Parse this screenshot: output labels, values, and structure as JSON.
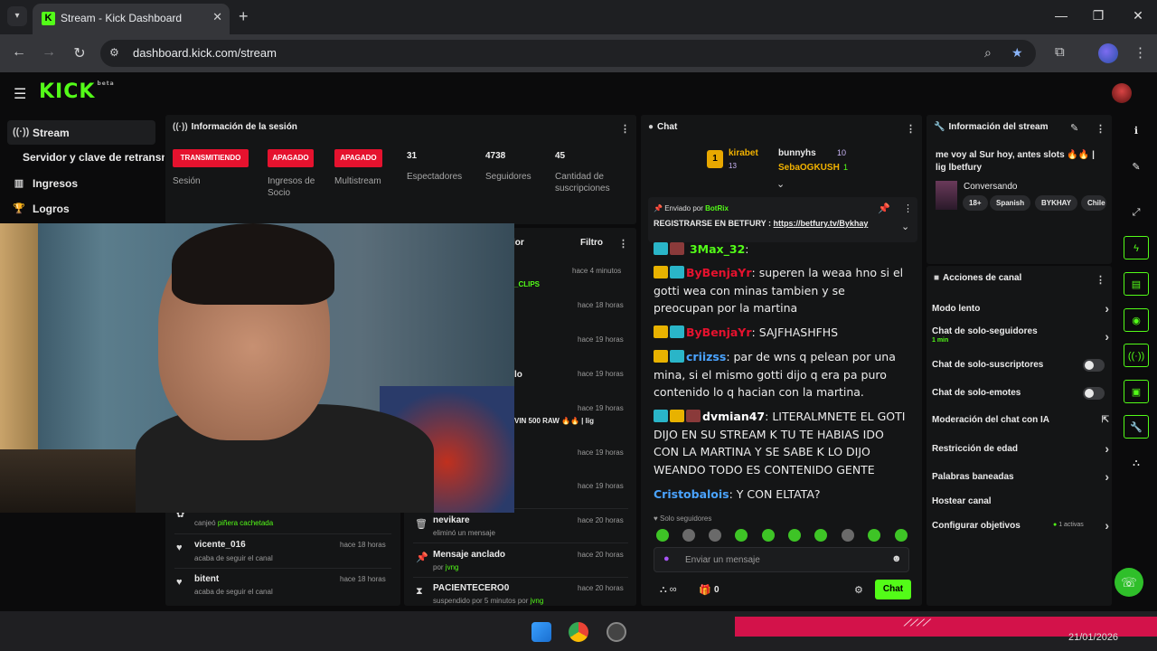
{
  "browser": {
    "tab_title": "Stream - Kick Dashboard",
    "url": "dashboard.kick.com/stream",
    "tab_close": "✕",
    "new_tab": "+"
  },
  "header": {
    "logo": "KICK"
  },
  "sidebar": {
    "items": [
      {
        "label": "Stream",
        "icon": "broadcast-icon"
      },
      {
        "label": "Servidor y clave de retransmisión"
      },
      {
        "label": "Ingresos",
        "icon": "chart-icon"
      },
      {
        "label": "Logros",
        "icon": "trophy-icon"
      }
    ]
  },
  "session": {
    "title": "Información de la sesión",
    "badges": [
      "TRANSMITIENDO",
      "APAGADO",
      "APAGADO"
    ],
    "badge_labels": [
      "Sesión",
      "Ingresos de Socio",
      "Multistream"
    ],
    "stats": [
      {
        "value": "31",
        "label": "Espectadores"
      },
      {
        "value": "4738",
        "label": "Seguidores"
      },
      {
        "value": "45",
        "label": "Cantidad de suscripciones"
      }
    ]
  },
  "activity": {
    "rows": [
      {
        "title": "",
        "sub_pre": "canjeó",
        "sub_hl": "piñera cachetada",
        "time": ""
      },
      {
        "title": "vicente_016",
        "sub": "acaba de seguir el canal",
        "time": "hace 18 horas"
      },
      {
        "title": "bitent",
        "sub": "acaba de seguir el canal",
        "time": "hace 18 horas"
      }
    ]
  },
  "modlog": {
    "title_tail": "lor",
    "filter": "Filtro",
    "times": [
      "hace 4 minutos",
      "hace 18 horas",
      "hace 19 horas",
      "hace 19 horas",
      "hace 19 horas",
      "hace 19 horas",
      "hace 19 horas"
    ],
    "fragments": [
      "_CLIPS",
      "lo",
      "VIN 500 RAW 🔥🔥 | lig"
    ],
    "rows": [
      {
        "title": "nevikare",
        "sub": "eliminó un mensaje",
        "time": "hace 20 horas"
      },
      {
        "title": "Mensaje anclado",
        "sub_pre": "por",
        "sub_hl": "jvng",
        "time": "hace 20 horas"
      },
      {
        "title": "PACIENTECERO0",
        "sub_pre": "suspendido por 5 minutos por",
        "sub_hl": "jvng",
        "time": "hace 20 horas"
      }
    ]
  },
  "chat": {
    "title": "Chat",
    "gifters": [
      {
        "name": "kirabet",
        "count": "13"
      },
      {
        "name": "bunnyhs",
        "count": "10"
      },
      {
        "name": "SebaOGKUSH",
        "count": "1"
      }
    ],
    "pinned": {
      "by_label": "Enviado por",
      "by_user": "BotRix",
      "text": "REGISTRARSE EN BETFURY :",
      "link": "https://betfury.tv/Bykhay"
    },
    "messages": [
      {
        "user": "3Max_32",
        "text": ""
      },
      {
        "user": "ByBenjaYr",
        "text": "superen la weaa hno si el gotti wea con minas tambien y se preocupan por la martina"
      },
      {
        "user": "ByBenjaYr",
        "text": "SAJFHASHFHS"
      },
      {
        "user": "criizss",
        "text": "par de wns q pelean por una mina, si el mismo gotti dijo q era pa puro contenido lo q hacian con la martina."
      },
      {
        "user": "dvmian47",
        "text": "LITERALMNETE EL GOTI DIJO EN SU STREAM K TU TE HABIAS IDO CON LA MARTINA Y SE SABE K LO DIJO WEANDO TODO ES CONTENIDO GENTE"
      },
      {
        "user": "Cristobalois",
        "text": "Y CON ELTATA?"
      }
    ],
    "followers_only": "Solo seguidores",
    "placeholder": "Enviar un mensaje",
    "viewer_count": "0",
    "send": "Chat"
  },
  "stream_info": {
    "title": "Información del stream",
    "stream_title": "me voy al Sur hoy, antes slots 🔥🔥 | lig lbetfury",
    "category": "Conversando",
    "tags": [
      "18+",
      "Spanish",
      "BYKHAY",
      "Chile"
    ]
  },
  "actions": {
    "title": "Acciones de canal",
    "items": [
      {
        "label": "Modo lento",
        "kind": "chevron"
      },
      {
        "label": "Chat de solo-seguidores",
        "sub": "1 min",
        "kind": "chevron"
      },
      {
        "label": "Chat de solo-suscriptores",
        "kind": "toggle"
      },
      {
        "label": "Chat de solo-emotes",
        "kind": "toggle"
      },
      {
        "label": "Moderación del chat con IA",
        "kind": "external"
      },
      {
        "label": "Restricción de edad",
        "kind": "chevron"
      },
      {
        "label": "Palabras baneadas",
        "kind": "chevron"
      },
      {
        "label": "Hostear canal",
        "kind": "none"
      },
      {
        "label": "Configurar objetivos",
        "sub": "1 activas",
        "kind": "chevron"
      }
    ]
  },
  "taskbar": {
    "date": "21/01/2026"
  },
  "colors": {
    "kick_green": "#53fc18",
    "live_red": "#e5122e",
    "panel_bg": "#141516"
  }
}
